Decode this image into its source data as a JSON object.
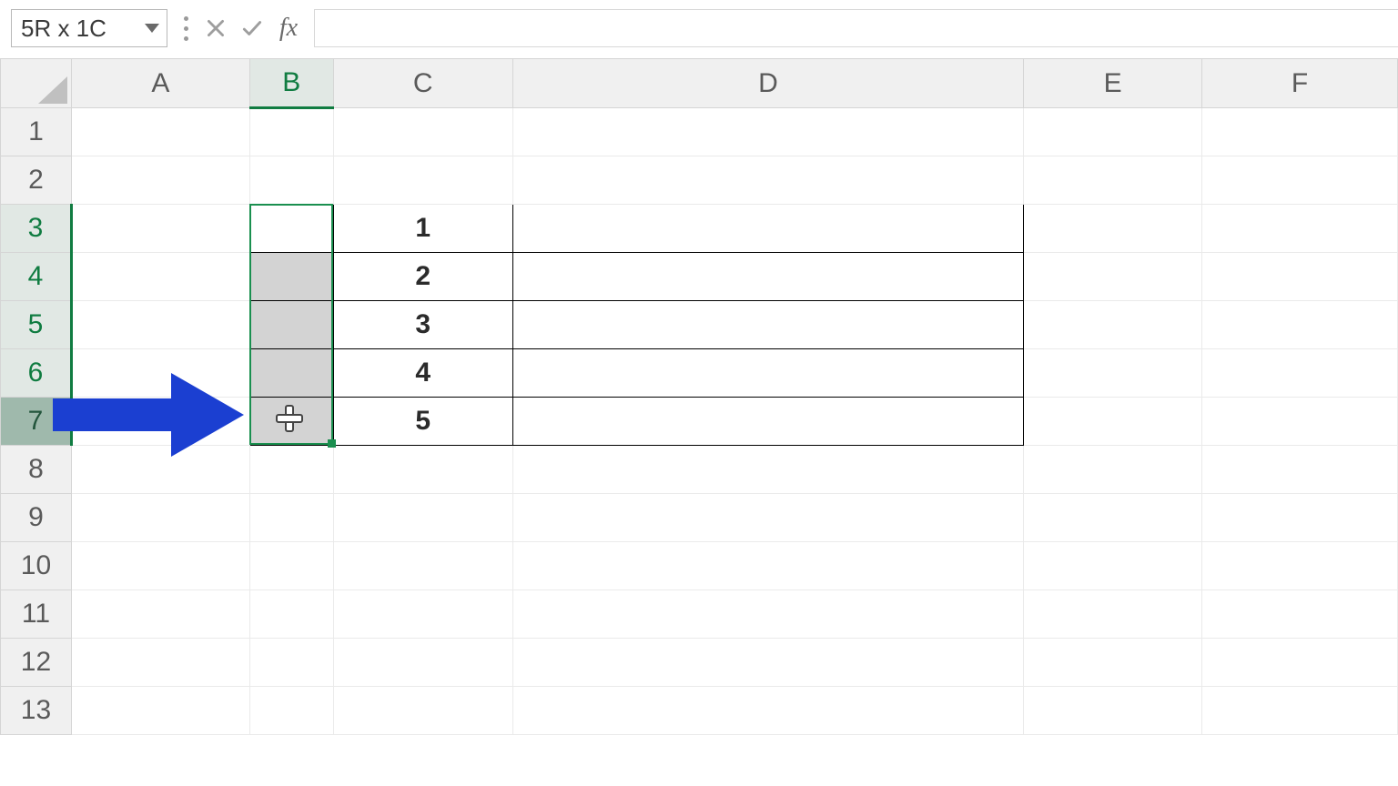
{
  "formula_bar": {
    "name_box_value": "5R x 1C",
    "fx_label": "fx",
    "formula_value": ""
  },
  "columns": [
    "A",
    "B",
    "C",
    "D",
    "E",
    "F"
  ],
  "rows": [
    "1",
    "2",
    "3",
    "4",
    "5",
    "6",
    "7",
    "8",
    "9",
    "10",
    "11",
    "12",
    "13"
  ],
  "selected_column": "B",
  "selected_rows": [
    "3",
    "4",
    "5",
    "6",
    "7"
  ],
  "cells": {
    "C3": "1",
    "C4": "2",
    "C5": "3",
    "C6": "4",
    "C7": "5"
  },
  "icons": {
    "cancel": "cancel-icon",
    "enter": "enter-icon",
    "dropdown": "chevron-down-icon",
    "fx": "fx-icon",
    "cursor": "plus-cursor-icon",
    "annotation": "blue-arrow-icon"
  },
  "annotation": {
    "arrow_color": "#1b3fd1",
    "points_to_cell": "B7"
  }
}
